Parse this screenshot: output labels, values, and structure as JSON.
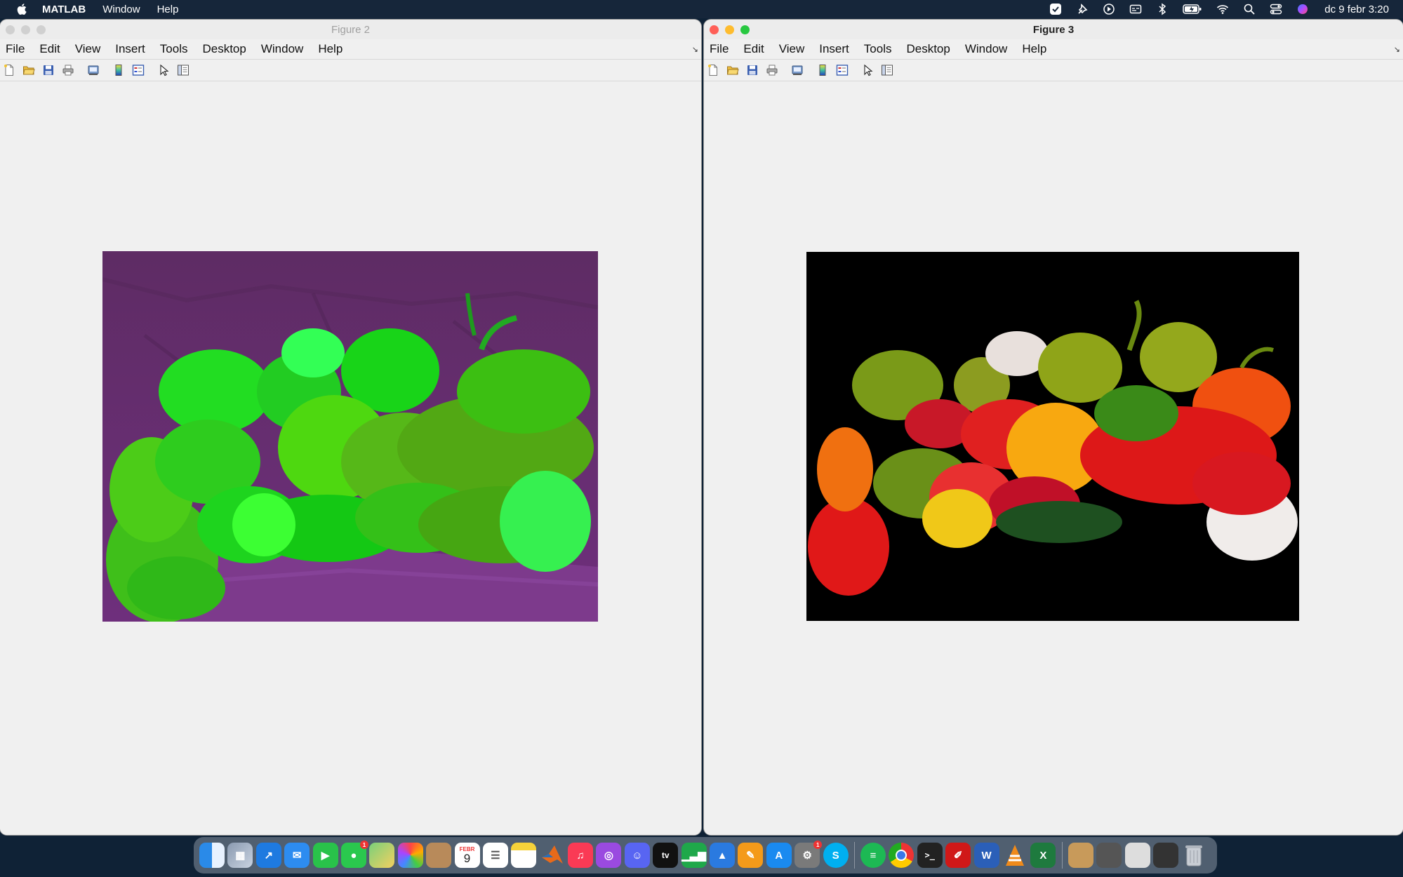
{
  "menubar": {
    "app_name": "MATLAB",
    "items": [
      "Window",
      "Help"
    ],
    "clock": "dc 9 febr  3:20",
    "status_icons": [
      "focus-icon",
      "pin-icon",
      "play-icon",
      "caption-icon",
      "bluetooth-icon",
      "battery-icon",
      "wifi-icon",
      "spotlight-icon",
      "control-center-icon",
      "siri-icon"
    ]
  },
  "windows": [
    {
      "title": "Figure 2",
      "active": false,
      "menu": [
        "File",
        "Edit",
        "View",
        "Insert",
        "Tools",
        "Desktop",
        "Window",
        "Help"
      ],
      "toolbar": [
        "new-figure-icon",
        "open-file-icon",
        "save-icon",
        "print-icon",
        "print-preview-icon",
        "colorbar-icon",
        "legend-icon",
        "select-arrow-icon",
        "property-inspector-icon"
      ],
      "image": "peppers-green-purple-segmented"
    },
    {
      "title": "Figure 3",
      "active": true,
      "menu": [
        "File",
        "Edit",
        "View",
        "Insert",
        "Tools",
        "Desktop",
        "Window",
        "Help"
      ],
      "toolbar": [
        "new-figure-icon",
        "open-file-icon",
        "save-icon",
        "print-icon",
        "print-preview-icon",
        "colorbar-icon",
        "legend-icon",
        "select-arrow-icon",
        "property-inspector-icon"
      ],
      "image": "peppers-masked-black-background"
    }
  ],
  "dock": {
    "apps": [
      "Finder",
      "Launchpad",
      "Safari",
      "Mail",
      "FaceTime",
      "Messages",
      "Maps",
      "Photos",
      "Contacts",
      "Calendar",
      "Reminders",
      "Notes",
      "MATLAB",
      "Music",
      "Podcasts",
      "Discord",
      "TV",
      "Numbers",
      "Keynote",
      "Pages",
      "App Store",
      "System Preferences",
      "Skype",
      "Spotify",
      "Chrome",
      "Terminal",
      "Acrobat",
      "Word",
      "VLC",
      "Excel"
    ],
    "calendar_day": "9",
    "calendar_month": "FEBR",
    "tv_label": "tv",
    "messages_badge": "1",
    "settings_badge": "1"
  }
}
